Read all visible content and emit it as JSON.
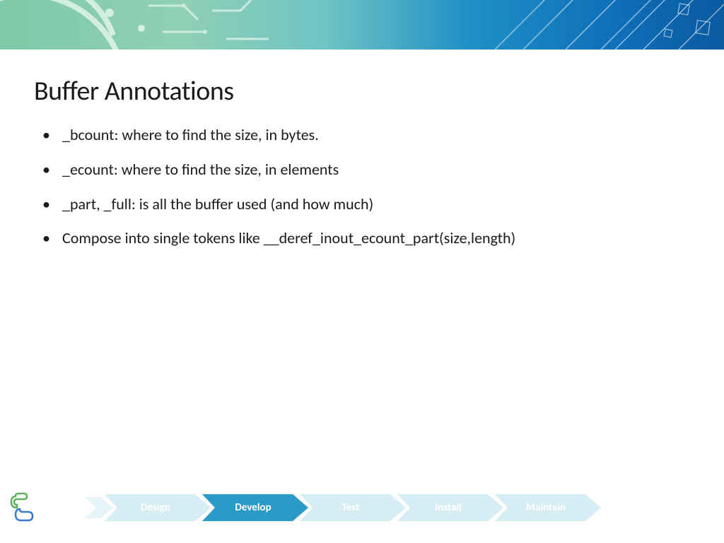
{
  "title": "Buffer Annotations",
  "bullets": [
    "_bcount: where to find the size, in bytes.",
    "_ecount: where to find the size, in elements",
    "_part, _full: is all the buffer used (and how much)",
    "Compose into single tokens like __deref_inout_ecount_part(size,length)"
  ],
  "process": {
    "steps": [
      "Design",
      "Develop",
      "Test",
      "Install",
      "Maintain"
    ],
    "active_index": 1
  }
}
